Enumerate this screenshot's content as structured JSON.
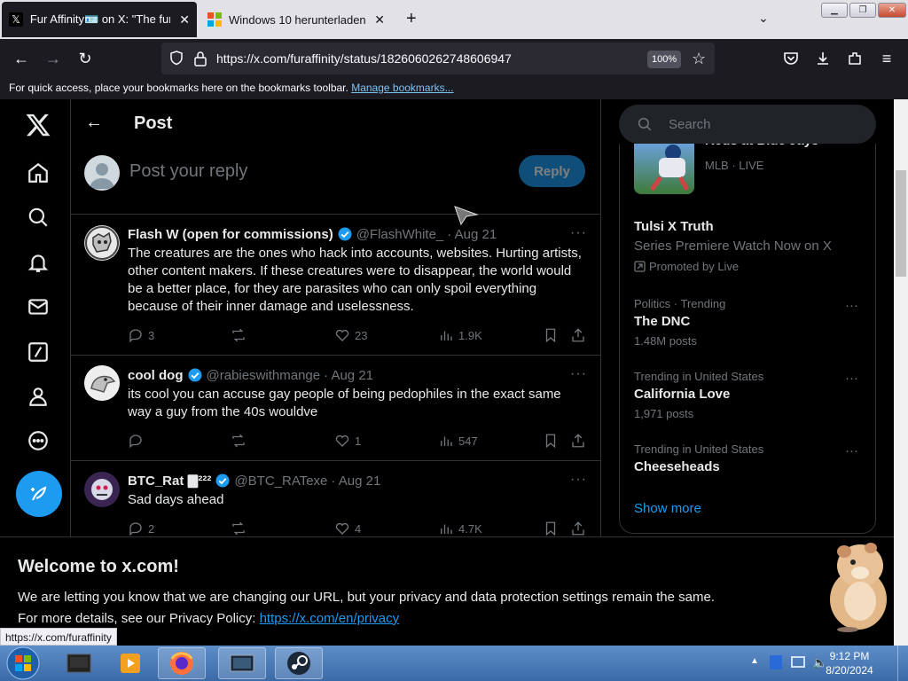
{
  "browser": {
    "tabs": [
      {
        "title": "Fur Affinity🪪 on X: \"The furry",
        "icon": "x-logo-icon",
        "active": true
      },
      {
        "title": "Windows 10 herunterladen",
        "icon": "windows-logo-icon",
        "active": false
      }
    ],
    "new_tab": "+",
    "url": "https://x.com/furaffinity/status/1826060262748606947",
    "zoom": "100%",
    "bookmarks_bar": {
      "text": "For quick access, place your bookmarks here on the bookmarks toolbar.",
      "link": "Manage bookmarks..."
    },
    "status_url": "https://x.com/furaffinity"
  },
  "header": {
    "title": "Post"
  },
  "reply_box": {
    "placeholder": "Post your reply",
    "button": "Reply"
  },
  "tweets": [
    {
      "name": "Flash W (open for commissions)",
      "handle": "@FlashWhite_",
      "date": "· Aug 21",
      "verified": true,
      "text": "The creatures are the ones who hack into accounts, websites. Hurting artists, other content makers. If these creatures were to disappear, the world would be a better place, for they are parasites who can only spoil everything because of their inner damage and uselessness.",
      "replies": "3",
      "reposts": "",
      "likes": "23",
      "views": "1.9K"
    },
    {
      "name": "cool dog",
      "handle": "@rabieswithmange",
      "date": "· Aug 21",
      "verified": true,
      "text": "its cool you can accuse gay people of being pedophiles in the exact same way a guy from the 40s wouldve",
      "replies": "",
      "reposts": "",
      "likes": "1",
      "views": "547"
    },
    {
      "name": "BTC_Rat 🀫²²²",
      "handle": "@BTC_RATexe",
      "date": "· Aug 21",
      "verified": true,
      "text": "Sad days ahead",
      "replies": "2",
      "reposts": "",
      "likes": "4",
      "views": "4.7K"
    }
  ],
  "sidebar": {
    "search_placeholder": "Search",
    "live_item": {
      "title": "Reds at Blue Jays",
      "meta": "MLB · LIVE"
    },
    "promoted": {
      "title": "Tulsi X Truth",
      "subtitle": "Series Premiere Watch Now on X",
      "promoted_by": "Promoted by Live"
    },
    "trends": [
      {
        "context": "Politics · Trending",
        "name": "The DNC",
        "posts": "1.48M posts"
      },
      {
        "context": "Trending in United States",
        "name": "California Love",
        "posts": "1,971 posts"
      },
      {
        "context": "Trending in United States",
        "name": "Cheeseheads",
        "posts": ""
      }
    ],
    "show_more": "Show more"
  },
  "banner": {
    "title": "Welcome to x.com!",
    "line1": "We are letting you know that we are changing our URL, but your privacy and data protection settings remain the same.",
    "line2_prefix": "For more details, see our Privacy Policy: ",
    "line2_link": "https://x.com/en/privacy"
  },
  "taskbar": {
    "time": "9:12 PM",
    "date": "8/20/2024"
  },
  "colors": {
    "accent": "#1d9bf0",
    "background": "#000000",
    "muted": "#71767b",
    "border": "#2f3336"
  }
}
